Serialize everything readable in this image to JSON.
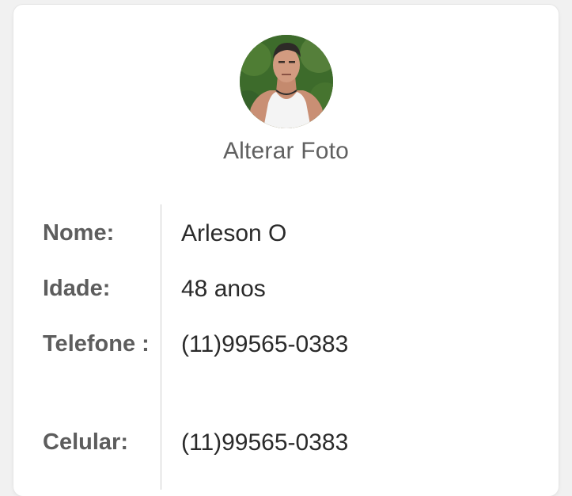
{
  "profile": {
    "change_photo_label": "Alterar Foto",
    "photo_alt": "Foto de perfil",
    "fields": [
      {
        "label": "Nome:",
        "value": "Arleson O"
      },
      {
        "label": "Idade:",
        "value": "48 anos"
      },
      {
        "label": "Telefone :",
        "value": "(11)99565-0383"
      },
      {
        "label": "Celular:",
        "value": "(11)99565-0383"
      }
    ]
  },
  "colors": {
    "card_background": "#ffffff",
    "page_background": "#f1f1f1",
    "label_text": "#5d5d5d",
    "value_text": "#2a2a2a",
    "divider": "#cfcfcf"
  }
}
